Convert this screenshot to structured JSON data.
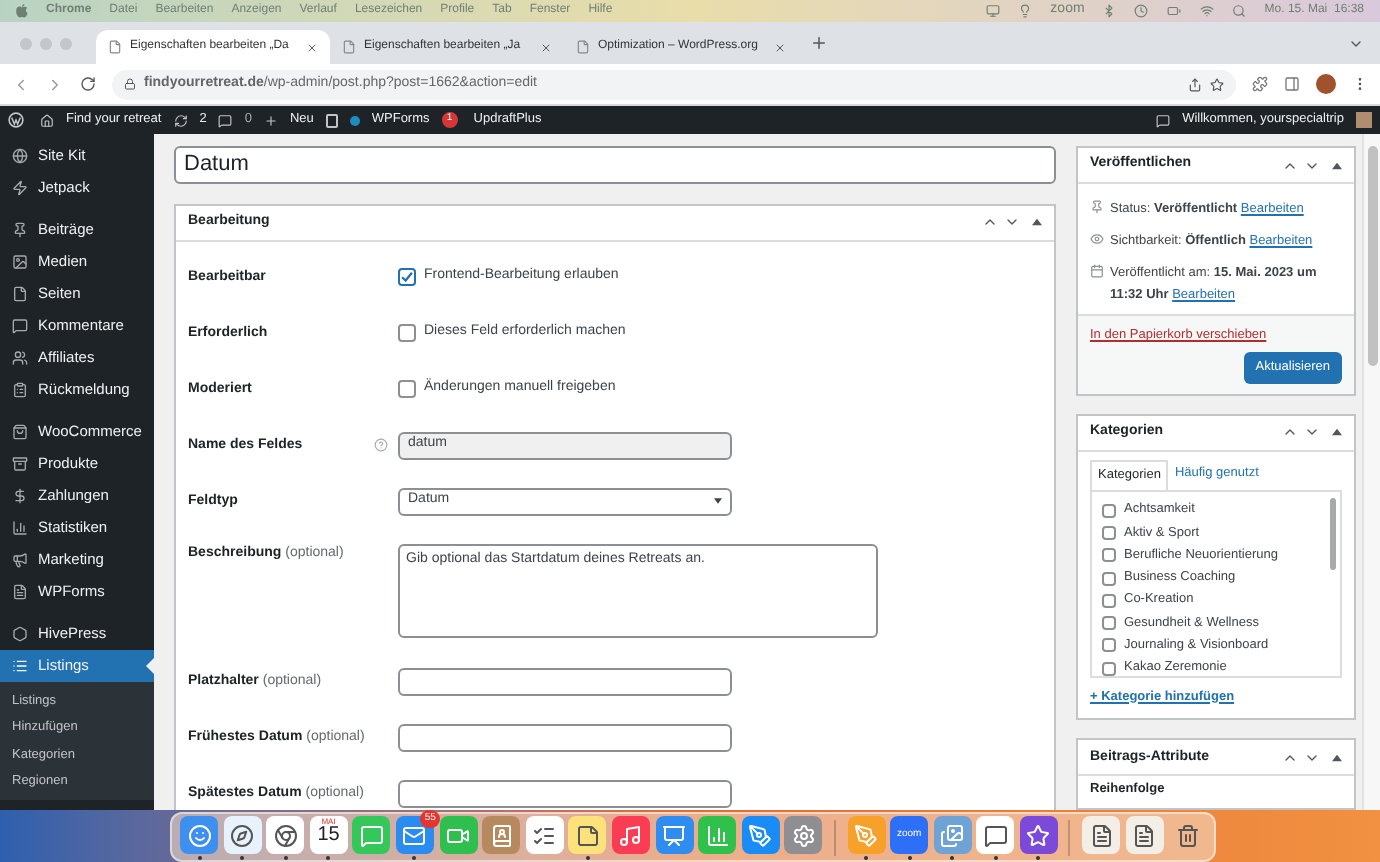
{
  "menu_bar": {
    "app": "Chrome",
    "items": [
      "Datei",
      "Bearbeiten",
      "Anzeigen",
      "Verlauf",
      "Lesezeichen",
      "Profile",
      "Tab",
      "Fenster",
      "Hilfe"
    ],
    "zoom": "zoom",
    "clock": "Mo. 15. Mai  16:38"
  },
  "tabs": [
    {
      "title": "Eigenschaften bearbeiten „Da",
      "selected": true
    },
    {
      "title": "Eigenschaften bearbeiten „Ja",
      "selected": false
    },
    {
      "title": "Optimization – WordPress.org",
      "selected": false
    }
  ],
  "address": "**findyourretreat.de**/wp-admin/post.php?post=1662&action=edit",
  "admin_bar": {
    "site": "Find your retreat",
    "updates": "2",
    "comments": "0",
    "new": "Neu",
    "wpforms": "WPForms",
    "wpforms_badge": "1",
    "updraft": "UpdraftPlus",
    "greeting": "Willkommen, yourspecialtrip"
  },
  "sidebar": {
    "groups": [
      {
        "items": [
          {
            "label": "Site Kit",
            "selected": false
          },
          {
            "label": "Jetpack",
            "selected": false
          }
        ]
      },
      {
        "items": [
          {
            "label": "Beiträge",
            "selected": false
          },
          {
            "label": "Medien",
            "selected": false
          },
          {
            "label": "Seiten",
            "selected": false
          },
          {
            "label": "Kommentare",
            "selected": false
          },
          {
            "label": "Affiliates",
            "selected": false
          },
          {
            "label": "Rückmeldung",
            "selected": false
          }
        ]
      },
      {
        "items": [
          {
            "label": "WooCommerce",
            "selected": false
          },
          {
            "label": "Produkte",
            "selected": false
          },
          {
            "label": "Zahlungen",
            "selected": false
          },
          {
            "label": "Statistiken",
            "selected": false
          },
          {
            "label": "Marketing",
            "selected": false
          },
          {
            "label": "WPForms",
            "selected": false
          }
        ]
      },
      {
        "items": [
          {
            "label": "HivePress",
            "selected": false
          },
          {
            "label": "Listings",
            "selected": true
          }
        ]
      }
    ],
    "submenu": [
      {
        "label": "Listings",
        "selected": false
      },
      {
        "label": "Hinzufügen",
        "selected": false
      },
      {
        "label": "Kategorien",
        "selected": false
      },
      {
        "label": "Regionen",
        "selected": false
      }
    ]
  },
  "title_field": "Datum",
  "panel": {
    "title": "Bearbeitung",
    "rows": [
      {
        "kind": "checkbox",
        "label": "Bearbeitbar",
        "text": "Frontend-Bearbeitung erlauben",
        "checked": true,
        "help": false
      },
      {
        "kind": "checkbox",
        "label": "Erforderlich",
        "text": "Dieses Feld erforderlich machen",
        "checked": false,
        "help": false
      },
      {
        "kind": "checkbox",
        "label": "Moderiert",
        "text": "Änderungen manuell freigeben",
        "checked": false,
        "help": false
      },
      {
        "kind": "readonly",
        "label": "Name des Feldes",
        "value": "datum",
        "help": true
      },
      {
        "kind": "select",
        "label": "Feldtyp",
        "value": "Datum",
        "help": false
      },
      {
        "kind": "textarea",
        "label": "Beschreibung",
        "optional": "(optional)",
        "value": "Gib optional das Startdatum deines Retreats an.",
        "help": false
      },
      {
        "kind": "text",
        "label": "Platzhalter",
        "optional": "(optional)",
        "help": false
      },
      {
        "kind": "text",
        "label": "Frühestes Datum",
        "optional": "(optional)",
        "help": false
      },
      {
        "kind": "text",
        "label": "Spätestes Datum",
        "optional": "(optional)",
        "help": false
      }
    ]
  },
  "publish": {
    "title": "Veröffentlichen",
    "lines": [
      {
        "text": "Status: **Veröffentlicht**",
        "link": "Bearbeiten"
      },
      {
        "text": "Sichtbarkeit: **Öffentlich**",
        "link": "Bearbeiten"
      },
      {
        "text": "Veröffentlicht am: **15. Mai. 2023 um 11:32 Uhr**",
        "link": "Bearbeiten"
      }
    ],
    "trash": "In den Papierkorb verschieben",
    "button": "Aktualisieren"
  },
  "categories": {
    "title": "Kategorien",
    "tabs": [
      {
        "label": "Kategorien",
        "selected": true
      },
      {
        "label": "Häufig genutzt",
        "selected": false
      }
    ],
    "items": [
      {
        "label": "Achtsamkeit",
        "checked": false
      },
      {
        "label": "Aktiv & Sport",
        "checked": false
      },
      {
        "label": "Berufliche Neuorientierung",
        "checked": false
      },
      {
        "label": "Business Coaching",
        "checked": false
      },
      {
        "label": "Co-Kreation",
        "checked": false
      },
      {
        "label": "Gesundheit & Wellness",
        "checked": false
      },
      {
        "label": "Journaling & Visionboard",
        "checked": false
      },
      {
        "label": "Kakao Zeremonie",
        "checked": false
      }
    ],
    "add": "+ Kategorie hinzufügen"
  },
  "attributes": {
    "title": "Beitrags-Attribute",
    "field": "Reihenfolge"
  },
  "dock": {
    "apps": [
      {
        "kind": "finder",
        "running": true
      },
      {
        "kind": "safari",
        "running": true
      },
      {
        "kind": "chrome",
        "running": true
      },
      {
        "kind": "calendar",
        "running": true,
        "month": "MAI",
        "day": "15"
      },
      {
        "kind": "messages",
        "running": false
      },
      {
        "kind": "mail",
        "running": true,
        "badge": "55"
      },
      {
        "kind": "facetime",
        "running": false
      },
      {
        "kind": "contacts",
        "running": false
      },
      {
        "kind": "reminders",
        "running": false
      },
      {
        "kind": "notes",
        "running": true
      },
      {
        "kind": "music",
        "running": false
      },
      {
        "kind": "keynote",
        "running": false
      },
      {
        "kind": "numbers",
        "running": false
      },
      {
        "kind": "appstore",
        "running": false
      },
      {
        "kind": "settings",
        "running": false
      },
      {
        "kind": "divider"
      },
      {
        "kind": "pages",
        "running": true
      },
      {
        "kind": "zoom",
        "running": true,
        "label": "zoom"
      },
      {
        "kind": "preview",
        "running": true
      },
      {
        "kind": "messenger",
        "running": true
      },
      {
        "kind": "imovie",
        "running": true
      },
      {
        "kind": "divider"
      },
      {
        "kind": "document",
        "running": false
      },
      {
        "kind": "document",
        "running": false
      },
      {
        "kind": "trash",
        "running": false
      }
    ]
  }
}
